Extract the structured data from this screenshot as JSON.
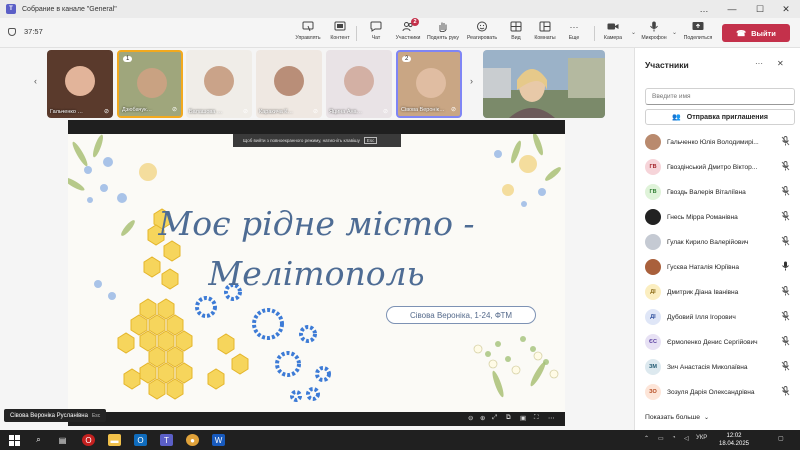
{
  "window": {
    "title": "Собрание в канале \"General\"",
    "controls": {
      "more": "…",
      "minimize": "—",
      "maximize": "☐",
      "close": "✕"
    }
  },
  "toolbar": {
    "timer": "37:57",
    "buttons": [
      {
        "label": "Управлять",
        "icon": "manage-icon"
      },
      {
        "label": "Контент",
        "icon": "share-content-icon"
      },
      {
        "label": "Чат",
        "icon": "chat-icon"
      },
      {
        "label": "Участники",
        "icon": "people-icon",
        "badge": "2"
      },
      {
        "label": "Поднять руку",
        "icon": "raise-hand-icon"
      },
      {
        "label": "Реагировать",
        "icon": "react-icon"
      },
      {
        "label": "Вид",
        "icon": "view-icon"
      },
      {
        "label": "Комнаты",
        "icon": "rooms-icon"
      },
      {
        "label": "Еще",
        "icon": "more-icon"
      },
      {
        "label": "Камера",
        "icon": "camera-icon"
      },
      {
        "label": "Микрофон",
        "icon": "microphone-icon"
      },
      {
        "label": "Поделиться",
        "icon": "share-icon"
      }
    ],
    "leave_label": "Выйти"
  },
  "strip": {
    "participants": [
      {
        "name": "Гальченко …",
        "bg": "#5a3a2c",
        "face": "#e2b49a",
        "hand": ""
      },
      {
        "name": "Дзюбачук…",
        "bg": "#9fa67c",
        "face": "#c9a282",
        "hand": "1",
        "highlight": "#f2a91e"
      },
      {
        "name": "Балашова …",
        "bg": "#f0ede8",
        "face": "#caa389",
        "hand": ""
      },
      {
        "name": "Каракича К…",
        "bg": "#efe8e2",
        "face": "#b98e78",
        "hand": ""
      },
      {
        "name": "Яцина Ана…",
        "bg": "#e9e3e6",
        "face": "#d3b0a4",
        "hand": ""
      },
      {
        "name": "Сівова Веронік…",
        "bg": "#c9a684",
        "face": "#e0bda2",
        "hand": "2",
        "highlight": "#7f85f5"
      }
    ]
  },
  "stage": {
    "fullscreen_banner": "Щоб вийти з повноекранного режиму, натисніть клавішу",
    "esc_key": "Esc",
    "slide": {
      "title_line1": "Моє рідне місто -",
      "title_line2": "Мелітополь",
      "subtitle": "Сівова Вероніка, 1-24, ФТМ"
    },
    "presenter": "Сівова Вероніка Русланівна",
    "presenter_cc": "Esc"
  },
  "panel": {
    "title": "Участники",
    "search_placeholder": "Введите имя",
    "invite_label": "Отправка приглашения",
    "participants": [
      {
        "initials": "",
        "name": "Гальченко Юлія Володимирі...",
        "mic": "muted",
        "bg": "#b98a6e",
        "fg": "#fff"
      },
      {
        "initials": "ГВ",
        "name": "Гвоздінський Дмитро Віктор...",
        "mic": "muted",
        "bg": "#f6d4d9",
        "fg": "#a4262c"
      },
      {
        "initials": "ГВ",
        "name": "Гвоздь Валерія Віталіївна",
        "mic": "muted",
        "bg": "#dff3d9",
        "fg": "#2f7d32"
      },
      {
        "initials": "",
        "name": "Гнесь Мірра Романівна",
        "mic": "muted",
        "bg": "#222222",
        "fg": "#fff"
      },
      {
        "initials": "",
        "name": "Гулак Кирило Валерійович",
        "mic": "muted",
        "bg": "#c5cad3",
        "fg": "#fff"
      },
      {
        "initials": "",
        "name": "Гусєва Наталія Юріївна",
        "mic": "on",
        "bg": "#a9603c",
        "fg": "#fff"
      },
      {
        "initials": "ДІ",
        "name": "Дмитрик Діана Іванівна",
        "mic": "muted",
        "bg": "#fbeec0",
        "fg": "#8a6914"
      },
      {
        "initials": "ДІ",
        "name": "Дубовий Ілля Ігорович",
        "mic": "muted",
        "bg": "#dfe6f7",
        "fg": "#2b4c9b"
      },
      {
        "initials": "ЄС",
        "name": "Єрмоленко Денис Сергійович",
        "mic": "muted",
        "bg": "#e7e1f4",
        "fg": "#5a3fa0"
      },
      {
        "initials": "ЗМ",
        "name": "Зич Анастасія Миколаївна",
        "mic": "muted",
        "bg": "#dde9ef",
        "fg": "#1f5870"
      },
      {
        "initials": "ЗО",
        "name": "Зозуля Дарія Олександрівна",
        "mic": "muted",
        "bg": "#fde5d8",
        "fg": "#b3471d"
      }
    ],
    "show_more": "Показать больше"
  },
  "taskbar": {
    "language": "УКР",
    "time": "12:02",
    "date": "18.04.2025"
  },
  "colors": {
    "accent": "#5b5fc7",
    "leave": "#c4314b",
    "slide_title": "#4e6c94"
  }
}
